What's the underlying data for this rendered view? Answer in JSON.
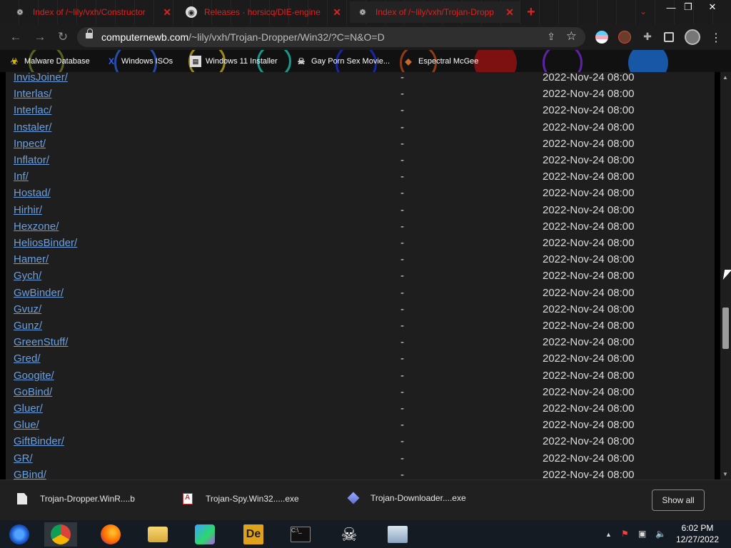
{
  "browser": {
    "tabs": [
      {
        "title": "Index of /~lily/vxh/Constructor",
        "active": false
      },
      {
        "title": "Releases · horsicq/DIE-engine",
        "active": false
      },
      {
        "title": "Index of /~lily/vxh/Trojan-Dropp",
        "active": true
      }
    ],
    "url_host": "computernewb.com",
    "url_path": "/~lily/vxh/Trojan-Dropper/Win32/?C=N&O=D",
    "bookmarks": [
      {
        "label": "Malware Database",
        "icon": "biohazard-icon"
      },
      {
        "label": "Windows ISOs",
        "icon": "x-logo-icon"
      },
      {
        "label": "Windows 11 Installer",
        "icon": "installer-icon"
      },
      {
        "label": "Gay Porn Sex Movie...",
        "icon": "pirate-icon"
      },
      {
        "label": "Espectral McGee",
        "icon": "fox-icon"
      }
    ]
  },
  "listing": {
    "rows": [
      {
        "name": "InvisJoiner/",
        "size": "-",
        "date": "2022-Nov-24 08:00"
      },
      {
        "name": "Interlas/",
        "size": "-",
        "date": "2022-Nov-24 08:00"
      },
      {
        "name": "Interlac/",
        "size": "-",
        "date": "2022-Nov-24 08:00"
      },
      {
        "name": "Instaler/",
        "size": "-",
        "date": "2022-Nov-24 08:00"
      },
      {
        "name": "Inpect/",
        "size": "-",
        "date": "2022-Nov-24 08:00"
      },
      {
        "name": "Inflator/",
        "size": "-",
        "date": "2022-Nov-24 08:00"
      },
      {
        "name": "Inf/",
        "size": "-",
        "date": "2022-Nov-24 08:00"
      },
      {
        "name": "Hostad/",
        "size": "-",
        "date": "2022-Nov-24 08:00"
      },
      {
        "name": "Hirhir/",
        "size": "-",
        "date": "2022-Nov-24 08:00"
      },
      {
        "name": "Hexzone/",
        "size": "-",
        "date": "2022-Nov-24 08:00"
      },
      {
        "name": "HeliosBinder/",
        "size": "-",
        "date": "2022-Nov-24 08:00"
      },
      {
        "name": "Hamer/",
        "size": "-",
        "date": "2022-Nov-24 08:00"
      },
      {
        "name": "Gych/",
        "size": "-",
        "date": "2022-Nov-24 08:00"
      },
      {
        "name": "GwBinder/",
        "size": "-",
        "date": "2022-Nov-24 08:00"
      },
      {
        "name": "Gvuz/",
        "size": "-",
        "date": "2022-Nov-24 08:00"
      },
      {
        "name": "Gunz/",
        "size": "-",
        "date": "2022-Nov-24 08:00"
      },
      {
        "name": "GreenStuff/",
        "size": "-",
        "date": "2022-Nov-24 08:00"
      },
      {
        "name": "Gred/",
        "size": "-",
        "date": "2022-Nov-24 08:00"
      },
      {
        "name": "Googite/",
        "size": "-",
        "date": "2022-Nov-24 08:00"
      },
      {
        "name": "GoBind/",
        "size": "-",
        "date": "2022-Nov-24 08:00"
      },
      {
        "name": "Gluer/",
        "size": "-",
        "date": "2022-Nov-24 08:00"
      },
      {
        "name": "Glue/",
        "size": "-",
        "date": "2022-Nov-24 08:00"
      },
      {
        "name": "GiftBinder/",
        "size": "-",
        "date": "2022-Nov-24 08:00"
      },
      {
        "name": "GR/",
        "size": "-",
        "date": "2022-Nov-24 08:00"
      },
      {
        "name": "GBind/",
        "size": "-",
        "date": "2022-Nov-24 08:00"
      }
    ]
  },
  "downloads": {
    "items": [
      {
        "name": "Trojan-Dropper.WinR....b",
        "icon": "document-icon"
      },
      {
        "name": "Trojan-Spy.Win32.....exe",
        "icon": "pdf-icon"
      },
      {
        "name": "Trojan-Downloader....exe",
        "icon": "gem-icon"
      }
    ],
    "show_all_label": "Show all"
  },
  "taskbar": {
    "apps": [
      "start-orb-icon",
      "chrome-icon",
      "firefox-icon",
      "file-explorer-icon",
      "messenger-icon",
      "de-app-icon",
      "cmd-icon",
      "skull-icon",
      "monitor-app-icon"
    ],
    "time": "6:02 PM",
    "date": "12/27/2022"
  },
  "colors": {
    "tab_text": "#e0211f",
    "link": "#6a9fe0",
    "page_bg": "#1e1e1e"
  }
}
